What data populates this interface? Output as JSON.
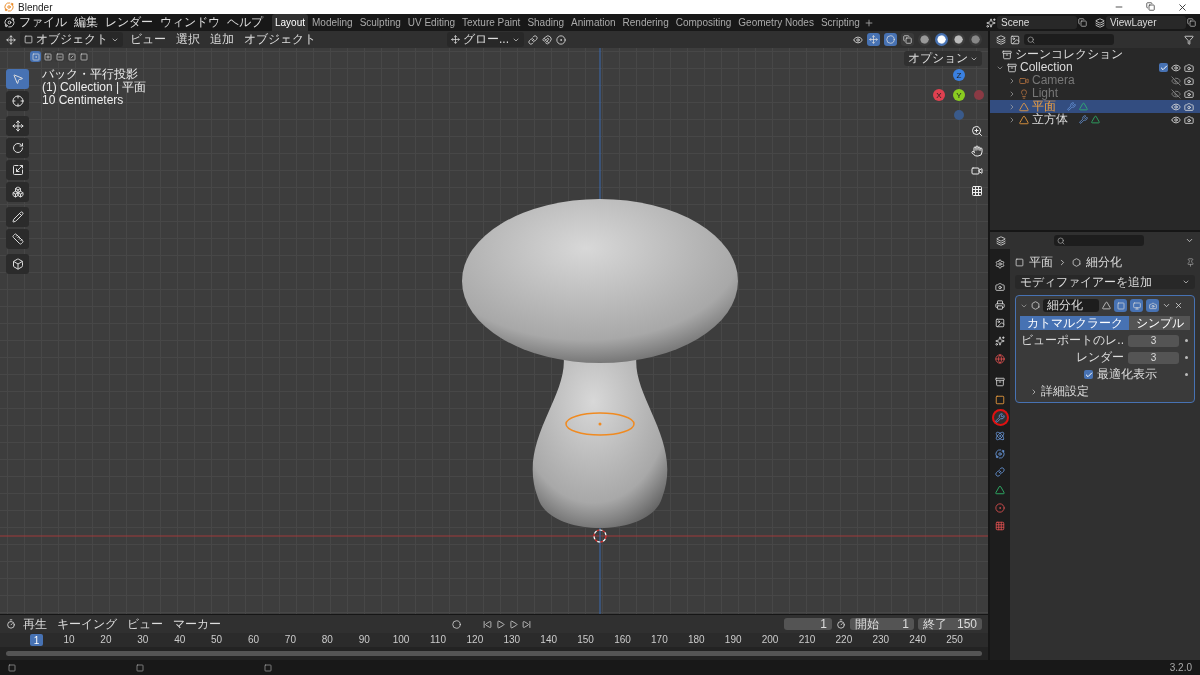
{
  "window": {
    "title": "Blender"
  },
  "menus": [
    "ファイル",
    "編集",
    "レンダー",
    "ウィンドウ",
    "ヘルプ"
  ],
  "workspaces": [
    {
      "label": "Layout",
      "selected": true
    },
    {
      "label": "Modeling",
      "selected": false
    },
    {
      "label": "Sculpting",
      "selected": false
    },
    {
      "label": "UV Editing",
      "selected": false
    },
    {
      "label": "Texture Paint",
      "selected": false
    },
    {
      "label": "Shading",
      "selected": false
    },
    {
      "label": "Animation",
      "selected": false
    },
    {
      "label": "Rendering",
      "selected": false
    },
    {
      "label": "Compositing",
      "selected": false
    },
    {
      "label": "Geometry Nodes",
      "selected": false
    },
    {
      "label": "Scripting",
      "selected": false
    }
  ],
  "scene": "Scene",
  "view_layer": "ViewLayer",
  "viewport": {
    "mode": "オブジェクト",
    "menus": [
      "ビュー",
      "選択",
      "追加",
      "オブジェクト"
    ],
    "orientation": "グロー...",
    "shading": [
      {
        "kind": "wireframe",
        "selected": false
      },
      {
        "kind": "solid",
        "selected": true
      },
      {
        "kind": "material",
        "selected": false
      },
      {
        "kind": "rendered",
        "selected": false
      }
    ],
    "select_modes": [
      {
        "kind": "set",
        "selected": true
      },
      {
        "kind": "extend",
        "selected": false
      },
      {
        "kind": "subtract",
        "selected": false
      },
      {
        "kind": "invert",
        "selected": false
      },
      {
        "kind": "intersect",
        "selected": false
      }
    ],
    "info": [
      "バック・平行投影",
      "(1) Collection | 平面",
      "10 Centimeters"
    ],
    "options": "オプション",
    "tools": [
      {
        "kind": "select",
        "selected": true
      },
      {
        "kind": "cursor",
        "selected": false
      },
      {
        "kind": "move",
        "selected": false
      },
      {
        "kind": "rotate",
        "selected": false
      },
      {
        "kind": "scale",
        "selected": false
      },
      {
        "kind": "transform",
        "selected": false
      },
      {
        "kind": "annotate",
        "selected": false
      },
      {
        "kind": "measure",
        "selected": false
      },
      {
        "kind": "add_cube",
        "selected": false
      }
    ],
    "gizmo": {
      "x": "X",
      "y": "Y",
      "z": "Z"
    }
  },
  "outliner": {
    "root": "シーンコレクション",
    "items": [
      {
        "name": "Collection",
        "kind": "collection",
        "checked": true,
        "visible": true,
        "selected": false,
        "expanded": true,
        "modifier": false,
        "children": [
          {
            "name": "Camera",
            "kind": "camera",
            "visible": false,
            "selected": false,
            "expanded": false,
            "modifier": false
          },
          {
            "name": "Light",
            "kind": "light",
            "visible": false,
            "selected": false,
            "expanded": false,
            "modifier": false
          },
          {
            "name": "平面",
            "kind": "mesh",
            "visible": true,
            "selected": true,
            "expanded": false,
            "modifier": true
          },
          {
            "name": "立方体",
            "kind": "mesh",
            "visible": true,
            "selected": false,
            "expanded": false,
            "modifier": true
          }
        ]
      }
    ]
  },
  "properties": {
    "tabs": [
      {
        "kind": "tool",
        "selected": false,
        "annotated": false
      },
      {
        "kind": "render",
        "selected": false,
        "annotated": false
      },
      {
        "kind": "output",
        "selected": false,
        "annotated": false
      },
      {
        "kind": "view_layer",
        "selected": false,
        "annotated": false
      },
      {
        "kind": "scene",
        "selected": false,
        "annotated": false
      },
      {
        "kind": "world",
        "selected": false,
        "annotated": false
      },
      {
        "kind": "collection",
        "selected": false,
        "annotated": false
      },
      {
        "kind": "object",
        "selected": false,
        "annotated": false
      },
      {
        "kind": "modifier",
        "selected": true,
        "annotated": true
      },
      {
        "kind": "particles",
        "selected": false,
        "annotated": false
      },
      {
        "kind": "physics",
        "selected": false,
        "annotated": false
      },
      {
        "kind": "constraints",
        "selected": false,
        "annotated": false
      },
      {
        "kind": "data",
        "selected": false,
        "annotated": false
      },
      {
        "kind": "material",
        "selected": false,
        "annotated": false
      },
      {
        "kind": "texture",
        "selected": false,
        "annotated": false
      }
    ],
    "breadcrumb": [
      "平面",
      "細分化"
    ],
    "add_modifier": "モディファイアーを追加",
    "modifier": {
      "name": "細分化",
      "expanded": true,
      "methods": [
        {
          "label": "カトマルクラーク",
          "selected": true
        },
        {
          "label": "シンプル",
          "selected": false
        }
      ],
      "fields": [
        {
          "label": "ビューポートのレ..",
          "value": "3"
        },
        {
          "label": "レンダー",
          "value": "3"
        }
      ],
      "optimal": {
        "label": "最適化表示",
        "checked": true
      },
      "advanced": "詳細設定"
    }
  },
  "timeline": {
    "menus": [
      "再生",
      "キーイング",
      "ビュー",
      "マーカー"
    ],
    "current_frame": "1",
    "start_label": "開始",
    "start": "1",
    "end_label": "終了",
    "end": "150",
    "playhead": "1",
    "ticks": [
      "10",
      "20",
      "30",
      "40",
      "50",
      "60",
      "70",
      "80",
      "90",
      "100",
      "110",
      "120",
      "130",
      "140",
      "150",
      "160",
      "170",
      "180",
      "190",
      "200",
      "210",
      "220",
      "230",
      "240",
      "250"
    ]
  },
  "status": {
    "version": "3.2.0"
  }
}
